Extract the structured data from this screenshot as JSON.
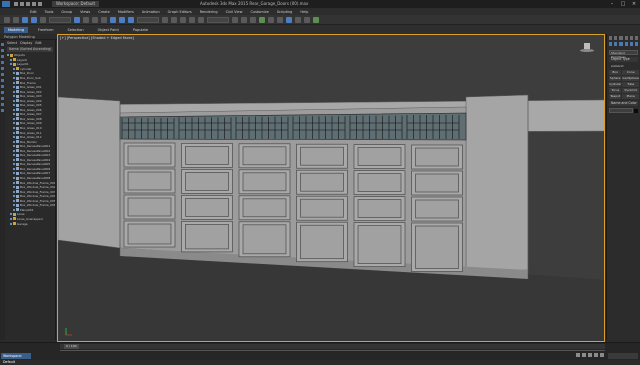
{
  "titlebar": {
    "workspace": "Workspace: Default",
    "title": "Autodesk 3ds Max 2015    Rear_Garage_Doors (00).max"
  },
  "menu": [
    "Edit",
    "Tools",
    "Group",
    "Views",
    "Create",
    "Modifiers",
    "Animation",
    "Graph Editors",
    "Rendering",
    "Civil View",
    "Customize",
    "Scripting",
    "Help"
  ],
  "ribbon": {
    "tabs": [
      "Modeling",
      "Freeform",
      "Selection",
      "Object Paint",
      "Populate"
    ],
    "active": "Modeling",
    "sub": "Polygon Modeling"
  },
  "explorer": {
    "tabs": [
      "Select",
      "Display",
      "Edit"
    ],
    "filter": "Name (Sorted Ascending)",
    "items": [
      "Objects",
      "Layer0",
      "Layer01",
      "cylinder",
      "Box_Door",
      "Box_Door_Sub",
      "Box_Frame",
      "Box_Glass_001",
      "Box_Glass_002",
      "Box_Glass_003",
      "Box_Glass_004",
      "Box_Glass_005",
      "Box_Glass_006",
      "Box_Glass_007",
      "Box_Glass_008",
      "Box_Glass_009",
      "Box_Glass_010",
      "Box_Glass_011",
      "Box_Glass_012",
      "Box_Mullion",
      "Box_RecessPanel001",
      "Box_RecessPanel002",
      "Box_RecessPanel003",
      "Box_RecessPanel004",
      "Box_RecessPanel005",
      "Box_RecessPanel006",
      "Box_RecessPanel007",
      "Box_RecessPanel008",
      "Box_Window_Frame_001",
      "Box_Window_Frame_002",
      "Box_Window_Frame_003",
      "Box_Window_Frame_004",
      "Box_Window_Frame_005",
      "Box_Window_Frame_006",
      "Plane001",
      "Lines",
      "Lines_Unwrapped",
      "Garage"
    ]
  },
  "viewport": {
    "label": "[+] [Perspective] [Shaded + Edged Faces]"
  },
  "command_panel": {
    "dropdown": "Standard Primitives",
    "object_type_header": "Object Type",
    "autogrid": "AutoGrid",
    "buttons": [
      "Box",
      "Cone",
      "Sphere",
      "GeoSphere",
      "Cylinder",
      "Tube",
      "Torus",
      "Pyramid",
      "Teapot",
      "Plane"
    ],
    "name_color_header": "Name and Color"
  },
  "status": {
    "workspace": "Workspace: Default",
    "frame": "0 / 100"
  }
}
